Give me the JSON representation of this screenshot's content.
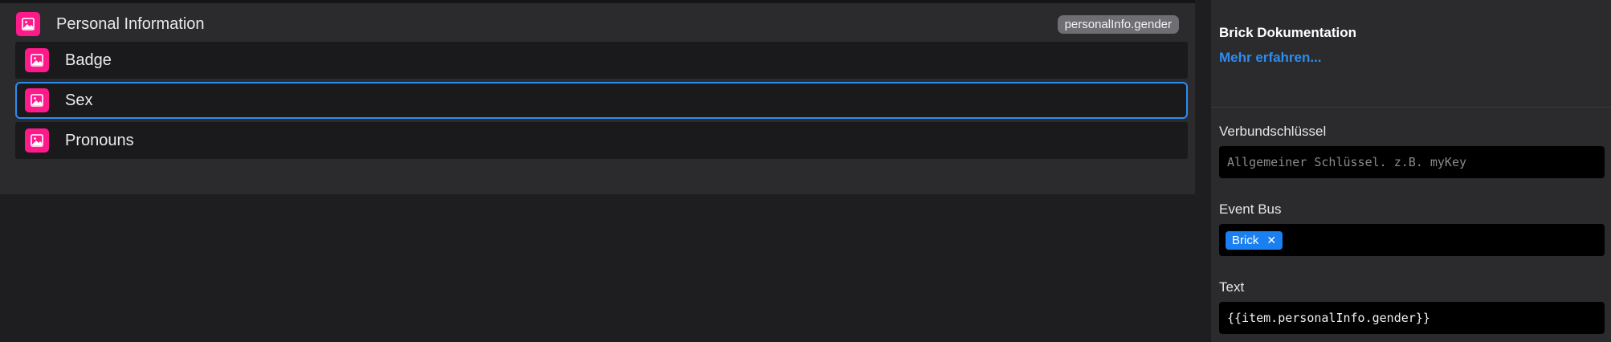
{
  "tree": {
    "header": {
      "label": "Personal Information",
      "icon": "image-icon",
      "badge": "personalInfo.gender"
    },
    "children": [
      {
        "label": "Badge",
        "icon": "image-icon",
        "selected": false
      },
      {
        "label": "Sex",
        "icon": "image-icon",
        "selected": true
      },
      {
        "label": "Pronouns",
        "icon": "image-icon",
        "selected": false
      }
    ]
  },
  "inspector": {
    "doc_title": "Brick Dokumentation",
    "doc_link": "Mehr erfahren...",
    "key_field": {
      "label": "Verbundschlüssel",
      "placeholder": "Allgemeiner Schlüssel. z.B. myKey",
      "value": ""
    },
    "event_bus": {
      "label": "Event Bus",
      "tags": [
        "Brick"
      ]
    },
    "text_field": {
      "label": "Text",
      "value": "{{item.personalInfo.gender}}"
    }
  },
  "colors": {
    "accent": "#2e8cf0",
    "brick_icon": "#ff1a8c",
    "tag": "#1a7ff0"
  }
}
